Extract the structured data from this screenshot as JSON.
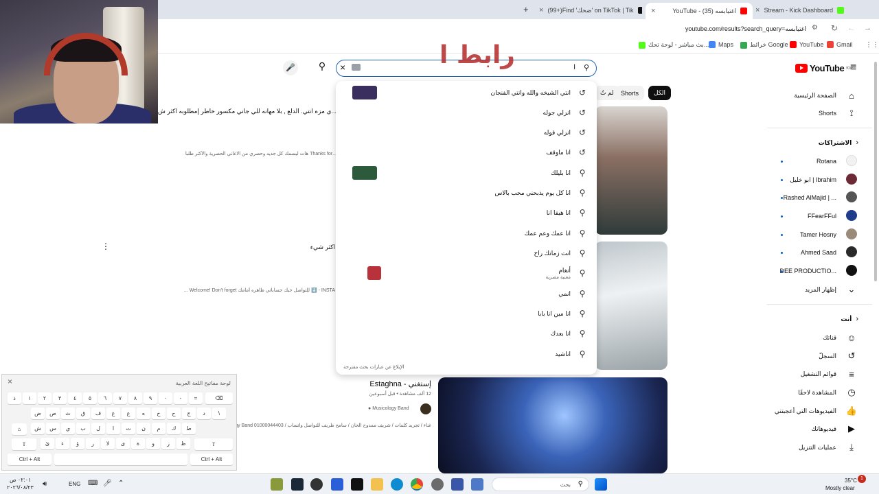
{
  "browser": {
    "tabs": [
      {
        "label": "Stream - Kick Dashboard",
        "color": "#53fc18"
      },
      {
        "label": "YouTube - (35) اغتيابسه",
        "color": "#ff0000"
      },
      {
        "label": "(99+)Find 'ضحك' on TikTok | Tik",
        "color": "#111111"
      }
    ],
    "new_tab": "+",
    "url": "youtube.com/results?search_query=اغتيابسه",
    "bookmarks": [
      {
        "label": "Gmail",
        "color": "#ea4335"
      },
      {
        "label": "YouTube",
        "color": "#ff0000"
      },
      {
        "label": "خرائط Google",
        "color": "#34a853"
      },
      {
        "label": "Maps",
        "color": "#4285f4"
      },
      {
        "label": "بث مباشر - لوحة تحك...",
        "color": "#53fc18"
      }
    ]
  },
  "overlay_text": "رابط ا",
  "youtube": {
    "logo": "YouTube",
    "country": "KW",
    "search_value": "ا",
    "chips": [
      {
        "label": "الكل",
        "active": true
      },
      {
        "label": "Shorts",
        "active": false
      },
      {
        "label": "لم تُ",
        "active": false
      }
    ],
    "suggestions": [
      {
        "text": "انتي الشيخه والله وانتي الفنجان",
        "icon": "history",
        "thumb": "#3a2e5f"
      },
      {
        "text": "انزلي جوله",
        "icon": "history"
      },
      {
        "text": "انزلي قوله",
        "icon": "history"
      },
      {
        "text": "انا ماوقف",
        "icon": "history"
      },
      {
        "text": "انا بليلك",
        "icon": "search",
        "thumb": "#2d5a3a"
      },
      {
        "text": "انا كل يوم يذبحني محب بالاس",
        "icon": "search"
      },
      {
        "text": "انا هيفا انا",
        "icon": "search"
      },
      {
        "text": "انا عمك وعم عمك",
        "icon": "search"
      },
      {
        "text": "انت زمانك راح",
        "icon": "search"
      },
      {
        "text": "أنغام",
        "icon": "search",
        "sub": "مغنية مصرية",
        "thumb": "#b8323c"
      },
      {
        "text": "انمي",
        "icon": "search"
      },
      {
        "text": "انا مين انا بابا",
        "icon": "search"
      },
      {
        "text": "انا بعدك",
        "icon": "search"
      },
      {
        "text": "اناشيد",
        "icon": "search"
      }
    ],
    "report": "الإبلاغ عن عبارات بحث مقترحة",
    "sidebar": {
      "main": [
        {
          "label": "الصفحة الرئيسية",
          "icon": "home-icon",
          "glyph": "⌂"
        },
        {
          "label": "Shorts",
          "icon": "shorts-icon",
          "glyph": "⟟"
        }
      ],
      "subs_title": "الاشتراكات",
      "subs": [
        {
          "label": "Rotana",
          "color": "#f2f2f2",
          "dot": true
        },
        {
          "label": "ابو خليل | Ibrahim",
          "color": "#6b2a35",
          "dot": true
        },
        {
          "label": "Rashed AlMajid | ...",
          "color": "#555555",
          "dot": true
        },
        {
          "label": "FFearFFul",
          "color": "#1f3d8a",
          "dot": true
        },
        {
          "label": "Tamer Hosny",
          "color": "#9a8a7a",
          "dot": true
        },
        {
          "label": "Ahmed Saad",
          "color": "#2a2a2a",
          "dot": true
        },
        {
          "label": "DEE PRODUCTIO...",
          "color": "#111111",
          "dot": true
        }
      ],
      "show_more": "إظهار المزيد",
      "you_title": "أنت",
      "you": [
        {
          "label": "قناتك",
          "icon": "channel-icon",
          "glyph": "☺"
        },
        {
          "label": "السجلّ",
          "icon": "history-icon",
          "glyph": "↺"
        },
        {
          "label": "قوائم التشغيل",
          "icon": "playlists-icon",
          "glyph": "≡"
        },
        {
          "label": "المشاهدة لاحقًا",
          "icon": "watch-later-icon",
          "glyph": "◷"
        },
        {
          "label": "الفيديوهات التي أعجبتني",
          "icon": "like-icon",
          "glyph": "👍"
        },
        {
          "label": "فيديوهاتك",
          "icon": "your-videos-icon",
          "glyph": "▶"
        },
        {
          "label": "عمليات التنزيل",
          "icon": "download-icon",
          "glyph": "⤓"
        }
      ]
    },
    "results": {
      "r1_title": "...ي مزه انتي. الدلع , بلا مهانه للي جاني مكسور خاطر إمطلوبه اكثر ش",
      "r1_desc": "...Thanks for هات ليسمك كل جديد وحصري من الاغاني الحصرية والأكثر طلبا",
      "r2_title": "اكثر شيء",
      "r2_desc": "INSTA - ⬇️ للتواصل حبك حساباتي ظاهره أمامك Welcome! Don't forget ...",
      "r3_title": "إستغني - Estaghna",
      "r3_meta": "12 ألف مشاهدة • قبل أسبوعين",
      "r3_channel": "Musicology Band",
      "r3_desc": "غناء / تجريد كلمات / شريف ممدوح الحان / سامح ظريف للتواصل واتساب / Musicology Band 01000044403"
    }
  },
  "keyboard": {
    "title": "لوحة مفاتيح اللغة العربية",
    "row1": [
      "ذ",
      "١",
      "٢",
      "٣",
      "٤",
      "٥",
      "٦",
      "٧",
      "٨",
      "٩",
      "٠",
      "-",
      "="
    ],
    "backspace": "⌫",
    "row2": [
      "ض",
      "ص",
      "ث",
      "ق",
      "ف",
      "غ",
      "ع",
      "ه",
      "خ",
      "ح",
      "ج",
      "د",
      "\\"
    ],
    "row3": [
      "ش",
      "س",
      "ي",
      "ب",
      "ل",
      "ا",
      "ت",
      "ن",
      "م",
      "ك",
      "ط"
    ],
    "row4": [
      "ئ",
      "ء",
      "ؤ",
      "ر",
      "لا",
      "ى",
      "ة",
      "و",
      "ز",
      "ظ"
    ],
    "ctrl_alt": "Ctrl + Alt",
    "shift": "⇧",
    "close": "×"
  },
  "taskbar": {
    "search_placeholder": "بحث",
    "lang": "ENG",
    "time": "٠٢:٠١ ص",
    "date": "٢٠٢٦/٠٨/٢٣",
    "weather": "35°C",
    "weather_desc": "Mostly clear",
    "notif": "1"
  }
}
